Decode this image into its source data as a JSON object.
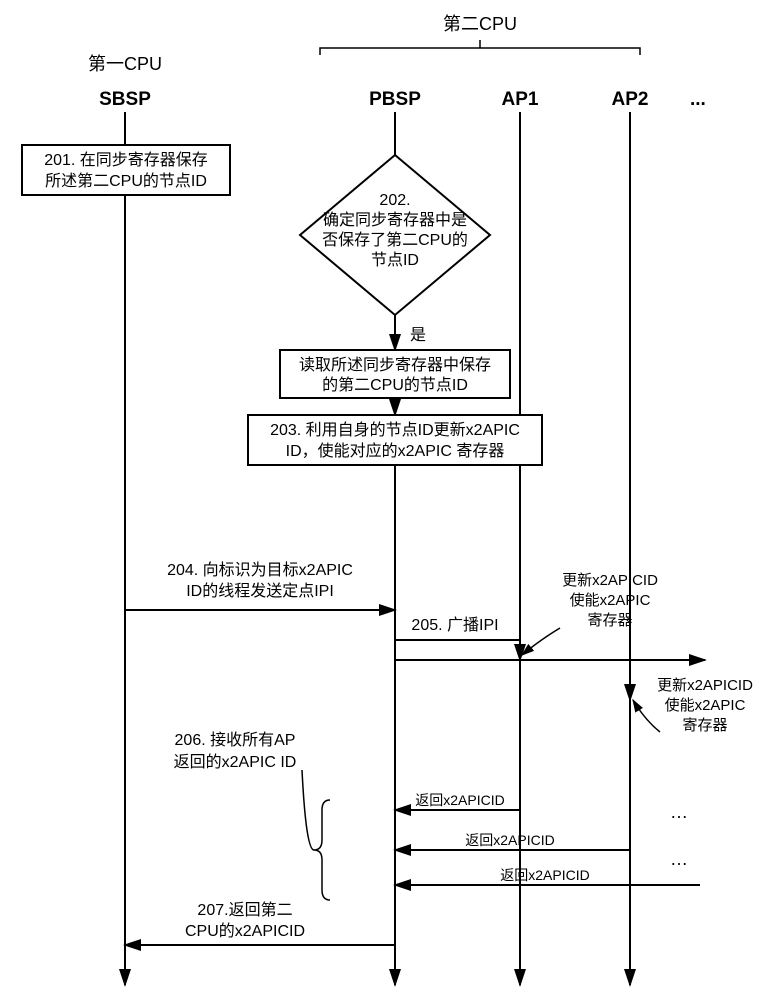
{
  "header": {
    "cpu1": "第一CPU",
    "cpu2": "第二CPU",
    "sbsp": "SBSP",
    "pbsp": "PBSP",
    "ap1": "AP1",
    "ap2": "AP2",
    "dots": "..."
  },
  "step201": {
    "line1": "201. 在同步寄存器保存",
    "line2": "所述第二CPU的节点ID"
  },
  "step202": {
    "line1": "202.",
    "line2": "确定同步寄存器中是",
    "line3": "否保存了第二CPU的",
    "line4": "节点ID",
    "yes": "是"
  },
  "readbox": {
    "line1": "读取所述同步寄存器中保存",
    "line2": "的第二CPU的节点ID"
  },
  "step203": {
    "line1": "203. 利用自身的节点ID更新x2APIC",
    "line2": "ID，使能对应的x2APIC 寄存器"
  },
  "step204": {
    "line1": "204. 向标识为目标x2APIC",
    "line2": "ID的线程发送定点IPI"
  },
  "step205": {
    "label": "205. 广播IPI"
  },
  "ap1box": {
    "line1": "更新x2APICID",
    "line2": "使能x2APIC",
    "line3": "寄存器"
  },
  "ap2box": {
    "line1": "更新x2APICID",
    "line2": "使能x2APIC",
    "line3": "寄存器"
  },
  "step206": {
    "line1": "206. 接收所有AP",
    "line2": "返回的x2APIC ID"
  },
  "returnLabels": {
    "r1": "返回x2APICID",
    "r2": "返回x2APICID",
    "r3": "返回x2APICID",
    "dots1": "…",
    "dots2": "…"
  },
  "step207": {
    "line1": "207.返回第二",
    "line2": "CPU的x2APICID"
  }
}
